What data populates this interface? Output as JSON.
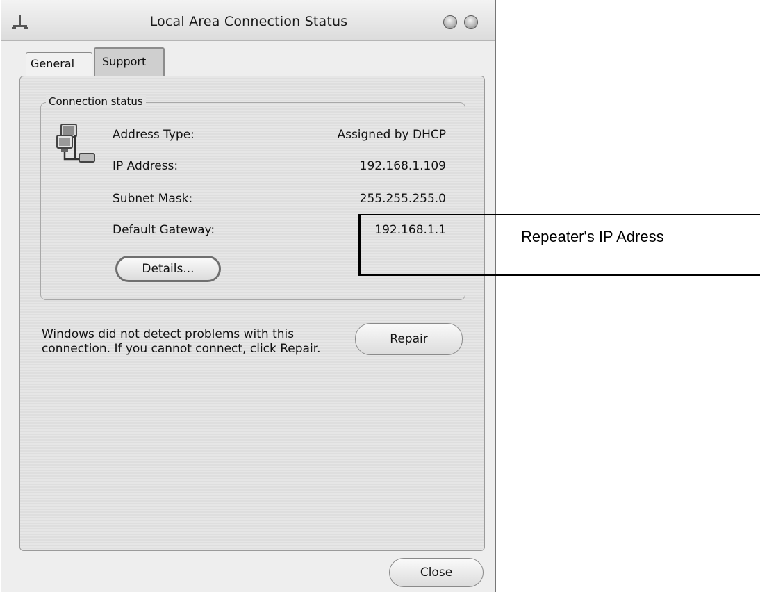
{
  "window": {
    "title": "Local Area Connection Status"
  },
  "tabs": [
    {
      "label": "General",
      "selected": false
    },
    {
      "label": "Support",
      "selected": true
    }
  ],
  "connection_status": {
    "legend": "Connection status",
    "icon": "network-connection-icon",
    "rows": [
      {
        "label": "Address Type:",
        "value": "Assigned by DHCP"
      },
      {
        "label": "IP Address:",
        "value": "192.168.1.109"
      },
      {
        "label": "Subnet Mask:",
        "value": "255.255.255.0"
      },
      {
        "label": "Default Gateway:",
        "value": "192.168.1.1"
      }
    ],
    "details_button": "Details..."
  },
  "support": {
    "message": "Windows did not detect problems with this connection. If you cannot connect, click Repair.",
    "repair_button": "Repair"
  },
  "footer": {
    "close_button": "Close"
  },
  "annotation": {
    "text": "Repeater's IP Adress"
  }
}
